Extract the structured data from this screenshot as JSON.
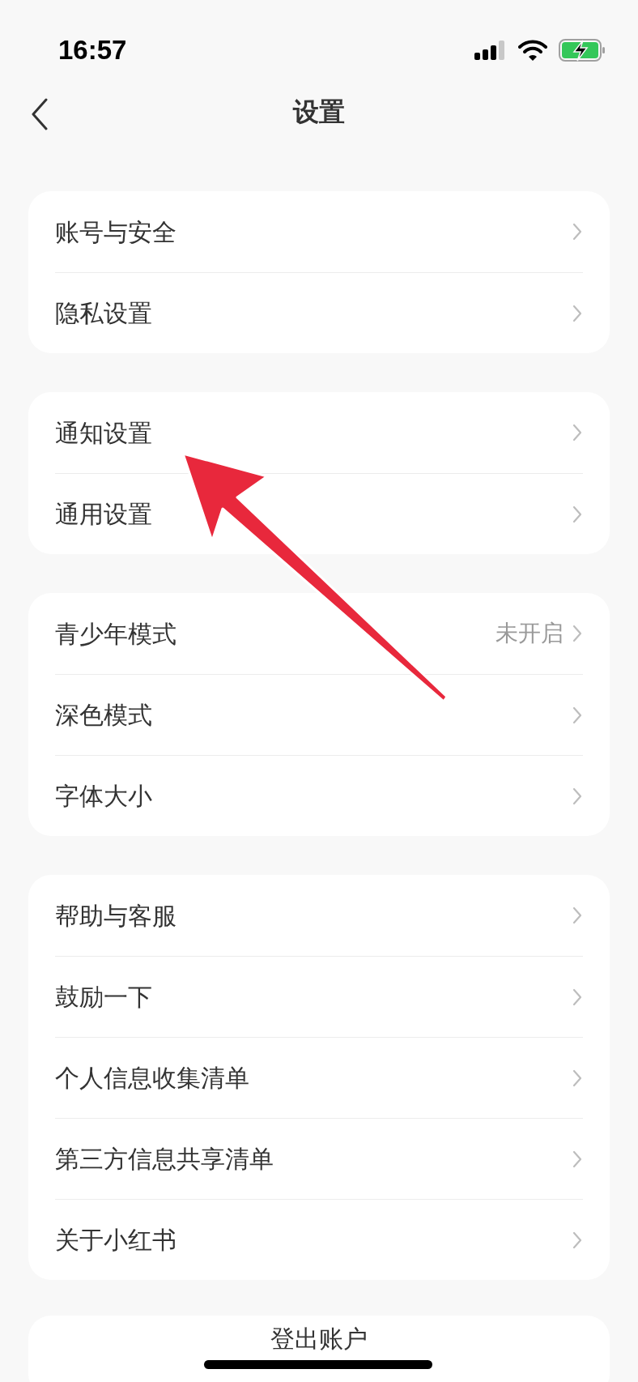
{
  "status_bar": {
    "time": "16:57"
  },
  "header": {
    "title": "设置"
  },
  "sections": [
    {
      "items": [
        {
          "label": "账号与安全"
        },
        {
          "label": "隐私设置"
        }
      ]
    },
    {
      "items": [
        {
          "label": "通知设置"
        },
        {
          "label": "通用设置"
        }
      ]
    },
    {
      "items": [
        {
          "label": "青少年模式",
          "value": "未开启"
        },
        {
          "label": "深色模式"
        },
        {
          "label": "字体大小"
        }
      ]
    },
    {
      "items": [
        {
          "label": "帮助与客服"
        },
        {
          "label": "鼓励一下"
        },
        {
          "label": "个人信息收集清单"
        },
        {
          "label": "第三方信息共享清单"
        },
        {
          "label": "关于小红书"
        }
      ]
    }
  ],
  "logout": {
    "label": "登出账户"
  }
}
